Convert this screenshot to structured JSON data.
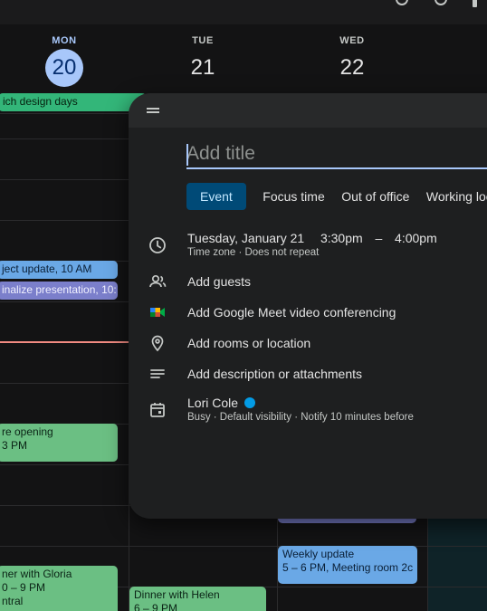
{
  "days": [
    {
      "dow": "MON",
      "num": "20",
      "today": true
    },
    {
      "dow": "TUE",
      "num": "21",
      "today": false
    },
    {
      "dow": "WED",
      "num": "22",
      "today": false
    }
  ],
  "events": {
    "allday_mon": "ich design days",
    "proj_update": "ject update, 10 AM",
    "finalize": "inalize presentation, 10:",
    "store_title": "re opening",
    "store_time": "3 PM",
    "dinner_gloria_title": "ner with Gloria",
    "dinner_gloria_time": "0 – 9 PM",
    "dinner_gloria_loc": "ntral",
    "dinner_helen_title": "Dinner with Helen",
    "dinner_helen_time": "6 – 9 PM",
    "weekly_title": "Weekly update",
    "weekly_time": "5 – 6 PM, Meeting room 2c"
  },
  "dialog": {
    "title_placeholder": "Add title",
    "tabs": [
      "Event",
      "Focus time",
      "Out of office",
      "Working loca"
    ],
    "date": "Tuesday, January 21",
    "start_time": "3:30pm",
    "dash": "–",
    "end_time": "4:00pm",
    "timezone_sub": "Time zone · Does not repeat",
    "add_guests": "Add guests",
    "add_meet": "Add Google Meet video conferencing",
    "add_rooms": "Add rooms or location",
    "add_description": "Add description or attachments",
    "calendar_owner": "Lori Cole",
    "calendar_sub": "Busy · Default visibility · Notify 10 minutes before"
  },
  "colors": {
    "today_accent": "#a8c7fa",
    "event_active_tab": "#004a77",
    "calendar_dot": "#039be5",
    "now_line": "#f28b82"
  }
}
